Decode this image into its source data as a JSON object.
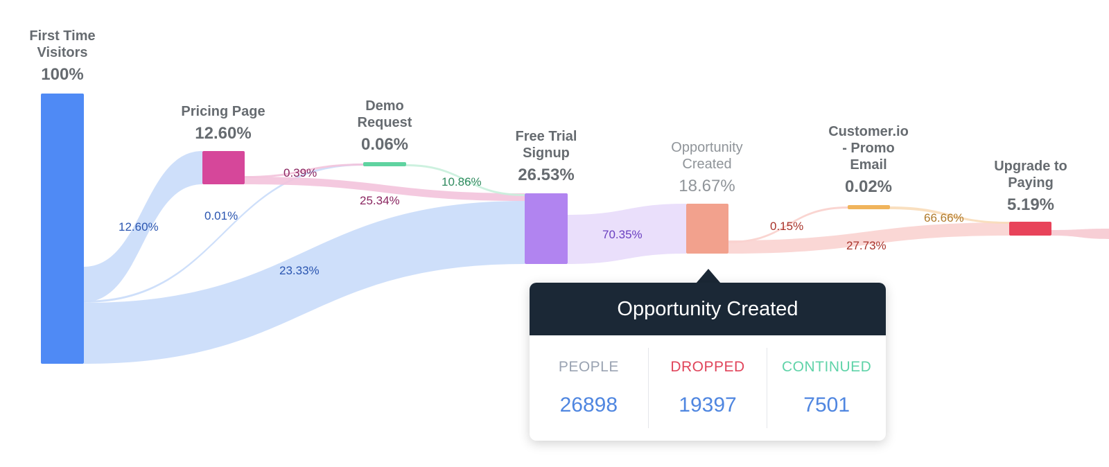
{
  "nodes": [
    {
      "name": "First Time Visitors",
      "line1": "First Time",
      "line2": "Visitors",
      "pct": "100%",
      "color": "#4f8af5"
    },
    {
      "name": "Pricing Page",
      "line1": "Pricing Page",
      "pct": "12.60%",
      "color": "#d6479a"
    },
    {
      "name": "Demo Request",
      "line1": "Demo",
      "line2": "Request",
      "pct": "0.06%",
      "color": "#5fd3a0"
    },
    {
      "name": "Free Trial Signup",
      "line1": "Free Trial",
      "line2": "Signup",
      "pct": "26.53%",
      "color": "#b184f0"
    },
    {
      "name": "Opportunity Created",
      "line1": "Opportunity",
      "line2": "Created",
      "pct": "18.67%",
      "color": "#f2a18d"
    },
    {
      "name": "Customer.io - Promo Email",
      "line1": "Customer.io",
      "line2": "- Promo",
      "line3": "Email",
      "pct": "0.02%",
      "color": "#f0b45c"
    },
    {
      "name": "Upgrade to Paying",
      "line1": "Upgrade to",
      "line2": "Paying",
      "pct": "5.19%",
      "color": "#e8435a"
    }
  ],
  "links": [
    {
      "from": "First Time Visitors",
      "to": "Pricing Page",
      "label": "12.60%",
      "color": "#c9dbfa",
      "label_color": "#2a55b0"
    },
    {
      "from": "First Time Visitors",
      "to": "Demo Request",
      "label": "0.01%",
      "color": "#c9dbfa",
      "label_color": "#2a55b0"
    },
    {
      "from": "First Time Visitors",
      "to": "Free Trial Signup",
      "label": "23.33%",
      "color": "#c9dbfa",
      "label_color": "#2a55b0"
    },
    {
      "from": "Pricing Page",
      "to": "Demo Request",
      "label": "0.39%",
      "color": "#f3c3dc",
      "label_color": "#8a2560"
    },
    {
      "from": "Pricing Page",
      "to": "Free Trial Signup",
      "label": "25.34%",
      "color": "#f3c3dc",
      "label_color": "#8a2560"
    },
    {
      "from": "Demo Request",
      "to": "Free Trial Signup",
      "label": "10.86%",
      "color": "#c8efdc",
      "label_color": "#2f8a5e"
    },
    {
      "from": "Free Trial Signup",
      "to": "Opportunity Created",
      "label": "70.35%",
      "color": "#e8dcfb",
      "label_color": "#6a3fc0"
    },
    {
      "from": "Opportunity Created",
      "to": "Customer.io - Promo Email",
      "label": "0.15%",
      "color": "#f9d0cc",
      "label_color": "#a8332a"
    },
    {
      "from": "Opportunity Created",
      "to": "Upgrade to Paying",
      "label": "27.73%",
      "color": "#f9d3d0",
      "label_color": "#a8332a"
    },
    {
      "from": "Customer.io - Promo Email",
      "to": "Upgrade to Paying",
      "label": "66.66%",
      "color": "#f8dcb8",
      "label_color": "#b07a2a"
    }
  ],
  "tooltip": {
    "title": "Opportunity Created",
    "people_label": "PEOPLE",
    "people_value": "26898",
    "people_color": "#9aa3b2",
    "dropped_label": "DROPPED",
    "dropped_value": "19397",
    "dropped_color": "#e0445a",
    "continued_label": "CONTINUED",
    "continued_value": "7501",
    "continued_color": "#5fd3a8"
  }
}
